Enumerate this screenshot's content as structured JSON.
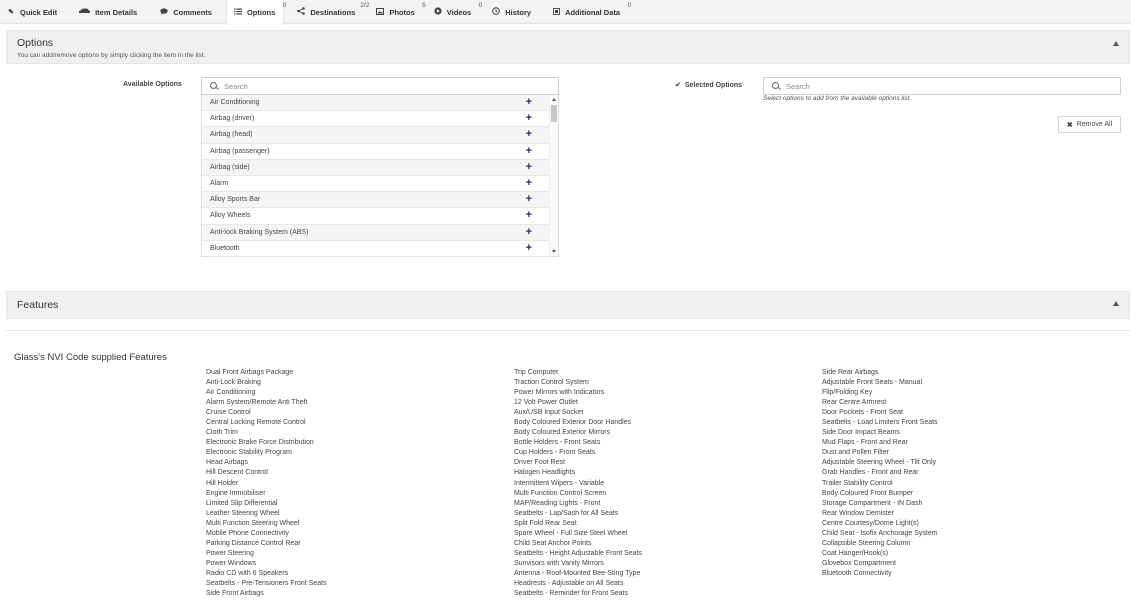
{
  "tabs": [
    {
      "label": "Quick Edit",
      "icon": "edit-icon",
      "count": ""
    },
    {
      "label": "Item Details",
      "icon": "car-icon",
      "count": ""
    },
    {
      "label": "Comments",
      "icon": "comment-icon",
      "count": ""
    },
    {
      "label": "Options",
      "icon": "list-icon",
      "count": "0"
    },
    {
      "label": "Destinations",
      "icon": "share-icon",
      "count": "2/2"
    },
    {
      "label": "Photos",
      "icon": "image-icon",
      "count": "5"
    },
    {
      "label": "Videos",
      "icon": "play-icon",
      "count": "0"
    },
    {
      "label": "History",
      "icon": "clock-icon",
      "count": ""
    },
    {
      "label": "Additional Data",
      "icon": "data-icon",
      "count": "0"
    }
  ],
  "options": {
    "title": "Options",
    "subtitle": "You can add/remove options by simply clicking the item in the list.",
    "available_label": "Available Options",
    "available_placeholder": "Search",
    "selected_label": "Selected Options",
    "selected_placeholder": "Search",
    "selected_hint": "Select options to add from the available options list.",
    "remove_all": "Remove All",
    "available_items": [
      "Air Conditioning",
      "Airbag (driver)",
      "Airbag (head)",
      "Airbag (passenger)",
      "Airbag (side)",
      "Alarm",
      "Alloy Sports Bar",
      "Alloy Wheels",
      "Anti-lock Braking System (ABS)",
      "Bluetooth"
    ]
  },
  "features": {
    "title": "Features",
    "nvi_title": "Glass's NVI Code supplied Features",
    "columns": [
      [
        "Dual Front Airbags Package",
        "Anti-Lock Braking",
        "Air Conditioning",
        "Alarm System/Remote Anti Theft",
        "Cruise Control",
        "Central Locking Remote Control",
        "Cloth Trim",
        "Electronic Brake Force Distribution",
        "Electronic Stability Program",
        "Head Airbags",
        "Hill Descent Control",
        "Hill Holder",
        "Engine Immobiliser",
        "Limited Slip Differential",
        "Leather Steering Wheel",
        "Multi Function Steering Wheel",
        "Mobile Phone Connectivity",
        "Parking Distance Control Rear",
        "Power Steering",
        "Power Windows",
        "Radio CD with 6 Speakers",
        "Seatbelts - Pre-Tensioners Front Seats",
        "Side Front Airbags"
      ],
      [
        "Trip Computer",
        "Traction Control System",
        "Power Mirrors with Indicators",
        "12 Volt Power Outlet",
        "Aux/USB Input Socket",
        "Body Coloured Exterior Door Handles",
        "Body Coloured Exterior Mirrors",
        "Bottle Holders - Front Seats",
        "Cup Holders - Front Seats",
        "Driver Foot Rest",
        "Halogen Headlights",
        "Intermittent Wipers - Variable",
        "Multi Function Control Screen",
        "MAP/Reading Lights - Front",
        "Seatbelts - Lap/Sash for All Seats",
        "Split Fold Rear Seat",
        "Spare Wheel - Full Size Steel Wheel",
        "Child Seat Anchor Points",
        "Seatbelts - Height Adjustable Front Seats",
        "Sunvisors with Vanity Mirrors",
        "Antenna - Roof-Mounted Bee-Sting Type",
        "Headrests - Adjustable on All Seats",
        "Seatbelts - Reminder for Front Seats"
      ],
      [
        "Side Rear Airbags",
        "Adjustable Front Seats - Manual",
        "Flip/Folding Key",
        "Rear Centre Armrest",
        "Door Pockets - Front Seat",
        "Seatbelts - Load Limiters Front Seats",
        "Side Door Impact Beams",
        "Mud Flaps - Front and Rear",
        "Dust and Pollen Filter",
        "Adjustable Steering Wheel - Tilt Only",
        "Grab Handles - Front and Rear",
        "Trailer Stability Control",
        "Body Coloured Front Bumper",
        "Storage Compartment - IN Dash",
        "Rear Window Demister",
        "Centre Courtesy/Dome Light(s)",
        "Child Seat - Isofix Anchorage System",
        "Collapsible Steering Column",
        "Coat Hanger/Hook(s)",
        "Glovebox Compartment",
        "Bluetooth Connectivity"
      ]
    ]
  }
}
